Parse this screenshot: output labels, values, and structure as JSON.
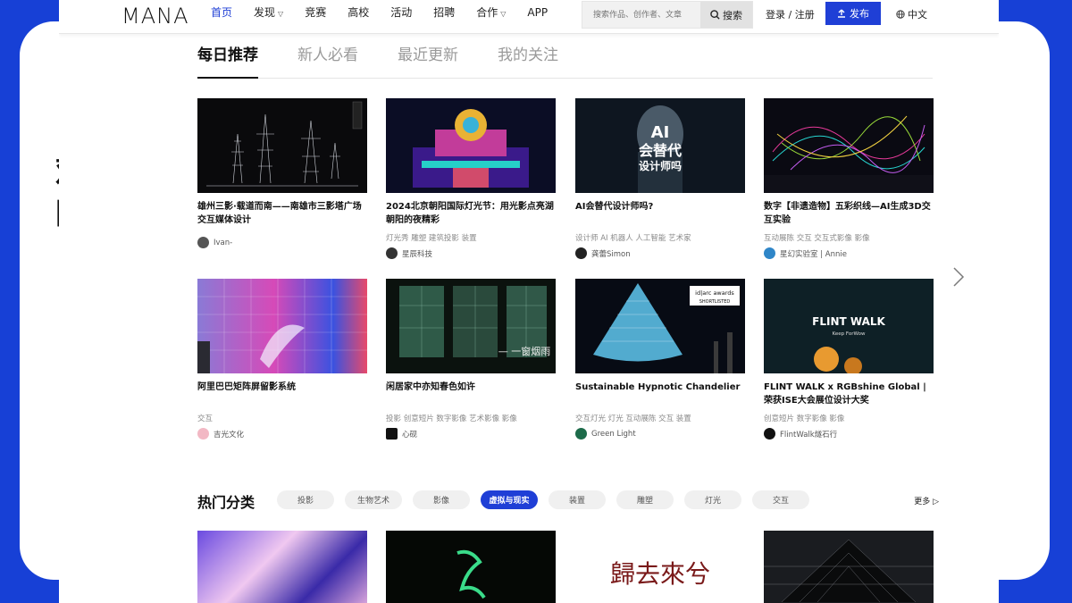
{
  "caption": [
    "观 摩",
    "网 站"
  ],
  "nav": {
    "logo": "MANA",
    "links": [
      {
        "label": "首页",
        "active": true,
        "caret": false
      },
      {
        "label": "发现",
        "active": false,
        "caret": true
      },
      {
        "label": "竞赛",
        "active": false,
        "caret": false
      },
      {
        "label": "高校",
        "active": false,
        "caret": false
      },
      {
        "label": "活动",
        "active": false,
        "caret": false
      },
      {
        "label": "招聘",
        "active": false,
        "caret": false
      },
      {
        "label": "合作",
        "active": false,
        "caret": true
      },
      {
        "label": "APP",
        "active": false,
        "caret": false
      }
    ],
    "search_placeholder": "搜索作品、创作者、文章",
    "search_button": "搜索",
    "login": "登录 / 注册",
    "publish": "发布",
    "language": "中文"
  },
  "tabs": [
    "每日推荐",
    "新人必看",
    "最近更新",
    "我的关注"
  ],
  "cards": [
    {
      "title": "雄州三影·载道而南——南雄市三影塔广场交互媒体设计",
      "tags": "",
      "author": "Ivan-"
    },
    {
      "title": "2024北京朝阳国际灯光节：用光影点亮湖朝阳的夜精彩",
      "tags": "灯光秀  雕塑  建筑投影  装置",
      "author": "星辰科技"
    },
    {
      "title": "AI会替代设计师吗?",
      "tags": "设计师  AI  机器人  人工智能  艺术家",
      "author": "龚蕾Simon"
    },
    {
      "title": "数字【非遗造物】五彩织线—AI生成3D交互实验",
      "tags": "互动展陈  交互  交互式影像  影像",
      "author": "星幻实验室 | Annie"
    },
    {
      "title": "阿里巴巴矩阵屏留影系统",
      "tags": "交互",
      "author": "吉光文化"
    },
    {
      "title": "闲居家中亦知春色如许",
      "tags": "投影  创意短片  数字影像  艺术影像  影像",
      "author": "心砚"
    },
    {
      "title": "Sustainable Hypnotic Chandelier",
      "tags": "交互灯光  灯光  互动展陈  交互  装置",
      "author": "Green Light"
    },
    {
      "title": "FLINT WALK x RGBshine Global | 荣获ISE大会展位设计大奖",
      "tags": "创意短片  数字影像  影像",
      "author": "FlintWalk燧石行"
    }
  ],
  "thumb_text": {
    "ai_line1": "AI",
    "ai_line2": "会替代",
    "ai_line3": "设计师吗",
    "poem": "— 一窗烟雨",
    "award": "id|arc awards",
    "award_sub": "SHORTLISTED",
    "flint": "FLINT WALK",
    "flint_sub": "Keep ForWow",
    "calligraphy": "歸去來兮"
  },
  "hot": {
    "title": "热门分类",
    "pills": [
      "投影",
      "生物艺术",
      "影像",
      "虚拟与现实",
      "装置",
      "雕塑",
      "灯光",
      "交互"
    ],
    "active_index": 3,
    "more": "更多"
  },
  "colors": {
    "brand": "#1f3fd6",
    "background": "#1740d6"
  }
}
